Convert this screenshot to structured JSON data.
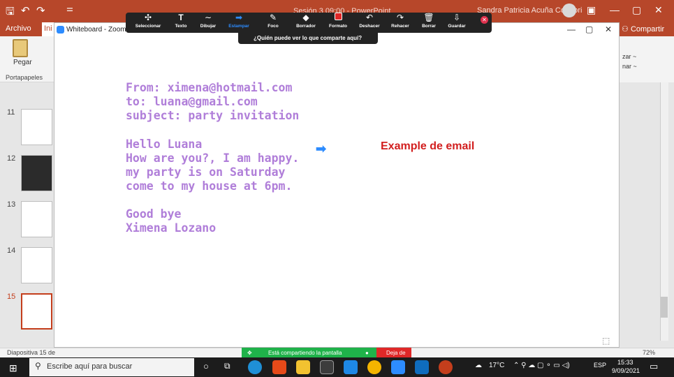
{
  "powerpoint": {
    "title": "Sesión 3 09:00 - PowerPoint",
    "user": "Sandra Patricia Acuña Condori",
    "tabs": {
      "archivo": "Archivo",
      "inicio": "Ini",
      "compartir": "Compartir"
    },
    "clipboard": {
      "paste": "Pegar",
      "group": "Portapapeles"
    },
    "right_ribbon": [
      "zar ~",
      "nar ~"
    ],
    "thumbnails": [
      "11",
      "12",
      "13",
      "14",
      "15"
    ],
    "status": {
      "slide_count": "Diapositiva 15 de",
      "zoom": "72%"
    }
  },
  "whiteboard": {
    "window_title": "Whiteboard - Zoom",
    "toolbar": [
      {
        "label": "Seleccionar",
        "icon": "move-icon"
      },
      {
        "label": "Texto",
        "icon": "text-icon"
      },
      {
        "label": "Dibujar",
        "icon": "draw-icon"
      },
      {
        "label": "Estampar",
        "icon": "stamp-icon",
        "active": true
      },
      {
        "label": "Foco",
        "icon": "spotlight-icon"
      },
      {
        "label": "Borrador",
        "icon": "eraser-icon"
      },
      {
        "label": "Formato",
        "icon": "format-icon",
        "color": "#e02828"
      },
      {
        "label": "Deshacer",
        "icon": "undo-icon"
      },
      {
        "label": "Rehacer",
        "icon": "redo-icon"
      },
      {
        "label": "Borrar",
        "icon": "trash-icon"
      },
      {
        "label": "Guardar",
        "icon": "save-icon"
      }
    ],
    "who_can_see": "¿Quién puede ver lo que comparte aquí?",
    "content": {
      "from": "From: ximena@hotmail.com",
      "to": "to: luana@gmail.com",
      "subject": "subject: party invitation",
      "greeting": "Hello Luana",
      "line1": "How are you?, I am happy.",
      "line2": "my party is on Saturday",
      "line3": "come to my house at 6pm.",
      "closing": "Good bye",
      "signature": "Ximena Lozano",
      "example_label": "Example de email"
    },
    "text_color": "#b07ed9",
    "label_color": "#d21e1e"
  },
  "sharing": {
    "text": "Está compartiendo la pantalla",
    "stop": "Deja de"
  },
  "taskbar": {
    "search_placeholder": "Escribe aquí para buscar",
    "weather": "17°C",
    "language": "ESP",
    "time": "15:33",
    "date": "9/09/2021"
  }
}
